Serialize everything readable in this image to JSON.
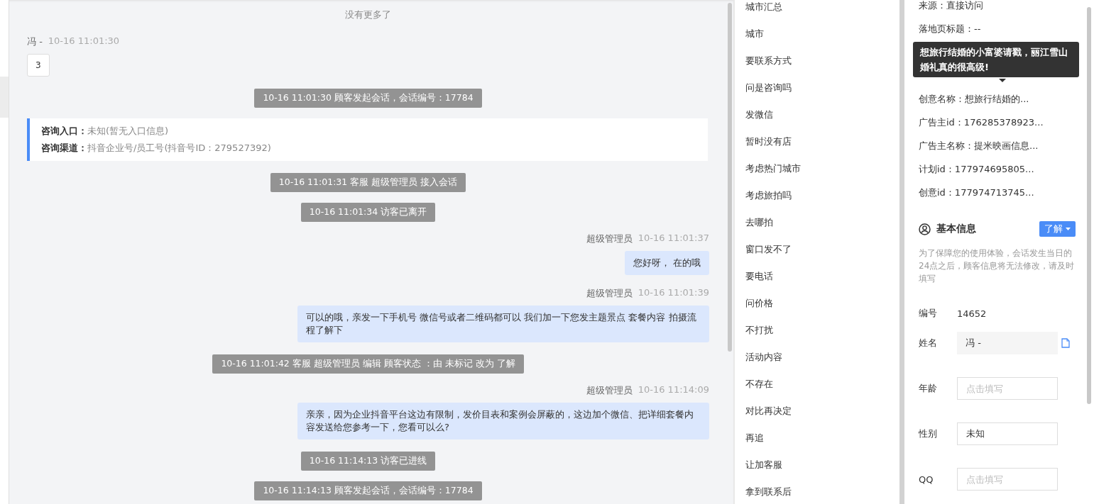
{
  "chat": {
    "messages": [
      {
        "kind": "notice",
        "text": "没有更多了"
      },
      {
        "kind": "visitor",
        "name": "冯 -",
        "time": "10-16 11:01:30",
        "text": "3"
      },
      {
        "kind": "system",
        "text": "10-16 11:01:30 顾客发起会话，会话编号：17784"
      },
      {
        "kind": "info",
        "lines": [
          "**咨询入口：**未知(暂无入口信息)",
          "**咨询渠道：**抖音企业号/员工号(抖音号ID：279527392)"
        ]
      },
      {
        "kind": "system",
        "text": "10-16 11:01:31 客服 超级管理员 接入会话"
      },
      {
        "kind": "system",
        "text": "10-16 11:01:34 访客已离开"
      },
      {
        "kind": "agent",
        "name": "超级管理员",
        "time": "10-16 11:01:37",
        "text": "您好呀， 在的哦"
      },
      {
        "kind": "agent",
        "name": "超级管理员",
        "time": "10-16 11:01:39",
        "text": "可以的哦，亲发一下手机号 微信号或者二维码都可以 我们加一下您发主题景点 套餐内容 拍摄流程了解下"
      },
      {
        "kind": "system",
        "text": "10-16 11:01:42 客服 超级管理员 编辑 顾客状态 ：由 未标记 改为 了解"
      },
      {
        "kind": "agent",
        "name": "超级管理员",
        "time": "10-16 11:14:09",
        "text": "亲亲，因为企业抖音平台这边有限制，发价目表和案例会屏蔽的，这边加个微信、把详细套餐内容发送给您参考一下，您看可以么?"
      },
      {
        "kind": "system",
        "text": "10-16 11:14:13 访客已进线"
      },
      {
        "kind": "system",
        "text": "10-16 11:14:13 顾客发起会话，会话编号：17784"
      }
    ]
  },
  "quick_replies": [
    "城市汇总",
    "城市",
    "要联系方式",
    "问是咨询吗",
    "发微信",
    "暂时没有店",
    "考虑热门城市",
    "考虑旅拍吗",
    "去哪拍",
    "窗口发不了",
    "要电话",
    "问价格",
    "不打扰",
    "活动内容",
    "不存在",
    "对比再决定",
    "再追",
    "让加客服",
    "拿到联系后"
  ],
  "source_info": [
    "来源：直接访问",
    "落地页标题：--",
    "创意名称：想旅行结婚的...",
    "广告主id：176285378923...",
    "广告主名称：提米映画信息...",
    "计划id：177974695805...",
    "创意id：177974713745..."
  ],
  "tooltip": "想旅行结婚的小富婆请戳，丽江雪山婚礼真的很高级!",
  "basic_info": {
    "title": "基本信息",
    "status": "了解",
    "notice": "为了保障您的使用体验，会话发生当日的24点之后，顾客信息将无法修改，请及时填写",
    "fields": [
      {
        "kind": "text",
        "label": "编号",
        "value": "14652"
      },
      {
        "kind": "readonly",
        "label": "姓名",
        "value": "冯 -"
      },
      {
        "kind": "input",
        "label": "年龄",
        "placeholder": "点击填写"
      },
      {
        "kind": "input",
        "label": "性别",
        "value": "未知"
      },
      {
        "kind": "input",
        "label": "QQ",
        "placeholder": "点击填写"
      }
    ]
  }
}
